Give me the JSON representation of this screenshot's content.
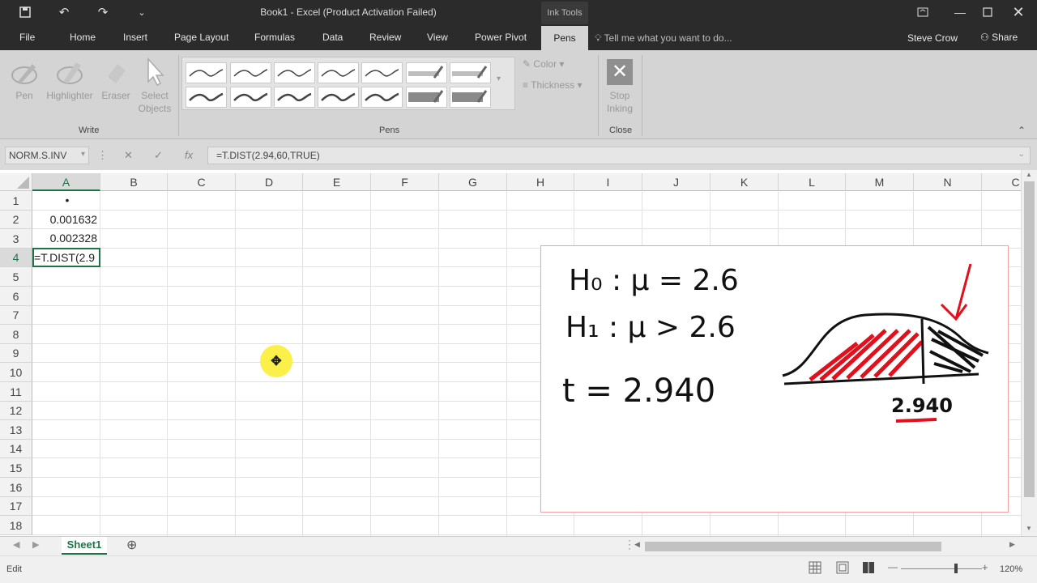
{
  "window": {
    "title": "Book1 - Excel (Product Activation Failed)",
    "context_tab": "Ink Tools"
  },
  "tabs": [
    "File",
    "Home",
    "Insert",
    "Page Layout",
    "Formulas",
    "Data",
    "Review",
    "View",
    "Power Pivot",
    "Pens"
  ],
  "active_tab": "Pens",
  "tell_me": "Tell me what you want to do...",
  "user": "Steve Crow",
  "share": "Share",
  "ribbon": {
    "write": {
      "label": "Write",
      "pen": "Pen",
      "highlighter": "Highlighter",
      "eraser": "Eraser",
      "select_objects_1": "Select",
      "select_objects_2": "Objects"
    },
    "pens": {
      "label": "Pens",
      "color": "Color",
      "thickness": "Thickness"
    },
    "close": {
      "label": "Close",
      "stop_1": "Stop",
      "stop_2": "Inking"
    }
  },
  "name_box": "NORM.S.INV",
  "formula": "=T.DIST(2.94,60,TRUE)",
  "columns": [
    "A",
    "B",
    "C",
    "D",
    "E",
    "F",
    "G",
    "H",
    "I",
    "J",
    "K",
    "L",
    "M",
    "N",
    "C"
  ],
  "rows": [
    "1",
    "2",
    "3",
    "4",
    "5",
    "6",
    "7",
    "8",
    "9",
    "10",
    "11",
    "12",
    "13",
    "14",
    "15",
    "16",
    "17",
    "18"
  ],
  "cells": {
    "A1": "•",
    "A2": "0.001632",
    "A3": "0.002328",
    "A4": "=T.DIST(2.9"
  },
  "sheet": {
    "name": "Sheet1"
  },
  "status": {
    "mode": "Edit",
    "zoom": "120%"
  },
  "ink": {
    "h0": "H₀ : μ = 2.6",
    "h1": "H₁ : μ > 2.6",
    "t": "t = 2.940",
    "curve_label": "2.940",
    "colors": {
      "ink": "#111111",
      "red": "#e0101c"
    }
  },
  "colors": {
    "accent": "#217346",
    "titlebar": "#2b2b2b",
    "ribbon": "#d4d4d4"
  }
}
